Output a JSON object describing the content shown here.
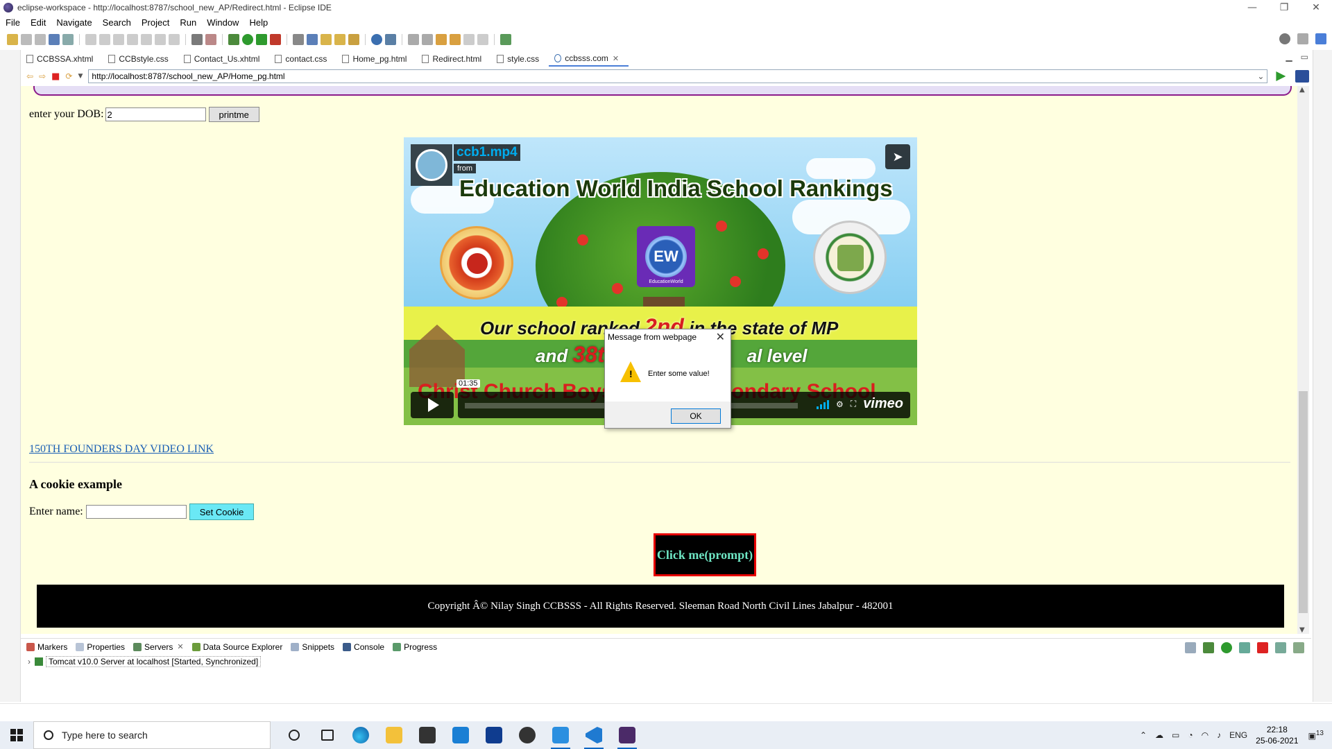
{
  "window": {
    "title": "eclipse-workspace - http://localhost:8787/school_new_AP/Redirect.html - Eclipse IDE",
    "controls": [
      "—",
      "❐",
      "✕"
    ]
  },
  "menu": [
    "File",
    "Edit",
    "Navigate",
    "Search",
    "Project",
    "Run",
    "Window",
    "Help"
  ],
  "editor_tabs": [
    {
      "label": "CCBSSA.xhtml"
    },
    {
      "label": "CCBstyle.css"
    },
    {
      "label": "Contact_Us.xhtml"
    },
    {
      "label": "contact.css"
    },
    {
      "label": "Home_pg.html"
    },
    {
      "label": "Redirect.html"
    },
    {
      "label": "style.css"
    },
    {
      "label": "ccbsss.com",
      "active": true,
      "close": "✕"
    }
  ],
  "address": {
    "url": "http://localhost:8787/school_new_AP/Home_pg.html"
  },
  "page": {
    "dob_label": "enter your DOB:",
    "dob_value": "2",
    "printme_label": "printme",
    "video": {
      "title": "ccb1.mp4",
      "from": "from",
      "headline": "Education World India School Rankings",
      "logo_mid_text": "EW",
      "logo_mid_caption": "EducationWorld",
      "rank_line1_a": "Our school ranked ",
      "rank_line1_num": "2nd",
      "rank_line1_b": " in the state of MP",
      "rank_line2_a": "and ",
      "rank_line2_num": "38t",
      "rank_line2_b": "al level",
      "rank_line3": "Christ Church Boys' Senior Secondary School",
      "timecode": "01:35",
      "brand": "vimeo"
    },
    "founders_link": "150TH FOUNDERS DAY VIDEO LINK",
    "cookie_heading": "A cookie example",
    "cookie_label": "Enter name:",
    "cookie_button": "Set Cookie",
    "clickme_label": "Click me(prompt)",
    "footer_text": "Copyright Â© Nilay Singh CCBSSS - All Rights Reserved. Sleeman Road North Civil Lines Jabalpur - 482001"
  },
  "dialog": {
    "title": "Message from webpage",
    "message": "Enter some value!",
    "ok": "OK",
    "close": "✕"
  },
  "panel": {
    "tabs": [
      "Markers",
      "Properties",
      "Servers",
      "Data Source Explorer",
      "Snippets",
      "Console",
      "Progress"
    ],
    "server_entry": "Tomcat v10.0 Server at localhost  [Started, Synchronized]"
  },
  "taskbar": {
    "search_placeholder": "Type here to search",
    "lang": "ENG",
    "time": "22:18",
    "date": "25-06-2021",
    "notif_count": "13"
  }
}
